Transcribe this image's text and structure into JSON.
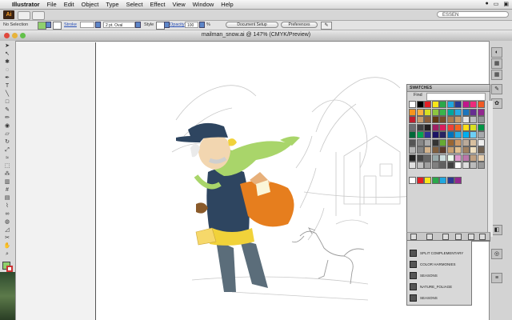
{
  "menubar": {
    "apple": "",
    "app_name": "Illustrator",
    "items": [
      "File",
      "Edit",
      "Object",
      "Type",
      "Select",
      "Effect",
      "View",
      "Window",
      "Help"
    ]
  },
  "appbar": {
    "logo": "Ai",
    "search_label": "ESSEN"
  },
  "controlbar": {
    "selection_label": "No Selection",
    "stroke_label": "Stroke",
    "brush_value": "2 pt. Oval",
    "style_label": "Style",
    "opacity_label": "Opacity",
    "opacity_value": "100",
    "percent_sign": "%",
    "document_setup": "Document Setup",
    "preferences": "Preferences",
    "fill_color": "#8fcf6c",
    "accent_color": "#5d86c8"
  },
  "document": {
    "title": "mailman_snow.ai @ 147% (CMYK/Preview)"
  },
  "swatches": {
    "title": "SWATCHES",
    "find_label": "Find"
  },
  "harmony": {
    "items": [
      "SPLIT COMPLEMENTARY",
      "COLOR HARMONIES",
      "SEASONS",
      "NATURE_FOLIAGE",
      "SEASONS"
    ]
  },
  "tools": {
    "icons": [
      "selection-icon",
      "direct-selection-icon",
      "magic-wand-icon",
      "lasso-icon",
      "pen-icon",
      "type-icon",
      "line-icon",
      "rectangle-icon",
      "paintbrush-icon",
      "pencil-icon",
      "blob-brush-icon",
      "eraser-icon",
      "rotate-icon",
      "scale-icon",
      "warp-icon",
      "free-transform-icon",
      "symbol-sprayer-icon",
      "graph-icon",
      "mesh-icon",
      "gradient-icon",
      "eyedropper-icon",
      "blend-icon",
      "live-paint-icon",
      "slice-icon",
      "scissors-icon",
      "hand-icon",
      "zoom-icon"
    ]
  }
}
